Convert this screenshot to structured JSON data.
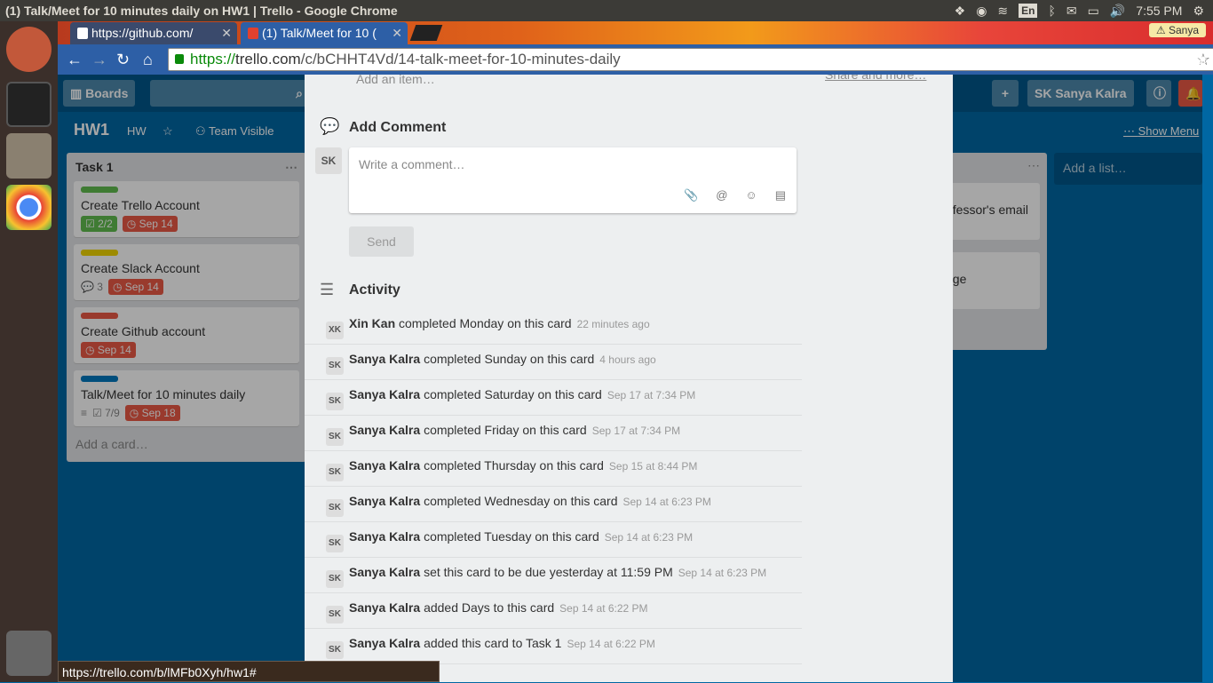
{
  "os": {
    "window_title": "(1) Talk/Meet for 10 minutes daily on HW1 | Trello - Google Chrome",
    "lang": "En",
    "clock": "7:55 PM"
  },
  "browser": {
    "tabs": [
      {
        "label": "https://github.com/"
      },
      {
        "label": "(1) Talk/Meet for 10 ("
      }
    ],
    "profile": "Sanya",
    "url_scheme": "https://",
    "url_host": "trello.com",
    "url_path": "/c/bCHHT4Vd/14-talk-meet-for-10-minutes-daily",
    "status_url": "https://trello.com/b/lMFb0Xyh/hw1#"
  },
  "trello": {
    "boards_label": "Boards",
    "user_initials": "SK",
    "user_name": "Sanya Kalra",
    "board_name": "HW1",
    "board_team": "HW",
    "visibility": "Team Visible",
    "show_menu": "Show Menu",
    "add_list": "Add a list…",
    "list": {
      "title": "Task 1",
      "cards": [
        {
          "title": "Create Trello Account",
          "label_color": "#61bd4f",
          "checklist": "2/2",
          "due": "Sep 14"
        },
        {
          "title": "Create Slack Account",
          "label_color": "#f2d600",
          "comments": "3",
          "due": "Sep 14"
        },
        {
          "title": "Create Github account",
          "label_color": "#eb5a46",
          "due": "Sep 14"
        },
        {
          "title": "Talk/Meet for 10 minutes daily",
          "label_color": "#0079bf",
          "checklist": "7/9",
          "due": "Sep 18"
        }
      ],
      "add_card": "Add a card…"
    },
    "list2_fragments": [
      "ofessor's email",
      "age"
    ]
  },
  "modal": {
    "add_item": "Add an item…",
    "share_more": "Share and more…",
    "add_comment_title": "Add Comment",
    "comment_placeholder": "Write a comment…",
    "send_label": "Send",
    "activity_title": "Activity",
    "activity": [
      {
        "initials": "XK",
        "name": "Xin Kan",
        "action": "completed Monday on this card",
        "time": "22 minutes ago"
      },
      {
        "initials": "SK",
        "name": "Sanya Kalra",
        "action": "completed Sunday on this card",
        "time": "4 hours ago"
      },
      {
        "initials": "SK",
        "name": "Sanya Kalra",
        "action": "completed Saturday on this card",
        "time": "Sep 17 at 7:34 PM"
      },
      {
        "initials": "SK",
        "name": "Sanya Kalra",
        "action": "completed Friday on this card",
        "time": "Sep 17 at 7:34 PM"
      },
      {
        "initials": "SK",
        "name": "Sanya Kalra",
        "action": "completed Thursday on this card",
        "time": "Sep 15 at 8:44 PM"
      },
      {
        "initials": "SK",
        "name": "Sanya Kalra",
        "action": "completed Wednesday on this card",
        "time": "Sep 14 at 6:23 PM"
      },
      {
        "initials": "SK",
        "name": "Sanya Kalra",
        "action": "completed Tuesday on this card",
        "time": "Sep 14 at 6:23 PM"
      },
      {
        "initials": "SK",
        "name": "Sanya Kalra",
        "action": "set this card to be due yesterday at 11:59 PM",
        "time": "Sep 14 at 6:23 PM"
      },
      {
        "initials": "SK",
        "name": "Sanya Kalra",
        "action": "added Days to this card",
        "time": "Sep 14 at 6:22 PM"
      },
      {
        "initials": "SK",
        "name": "Sanya Kalra",
        "action": "added this card to Task 1",
        "time": "Sep 14 at 6:22 PM"
      }
    ]
  }
}
